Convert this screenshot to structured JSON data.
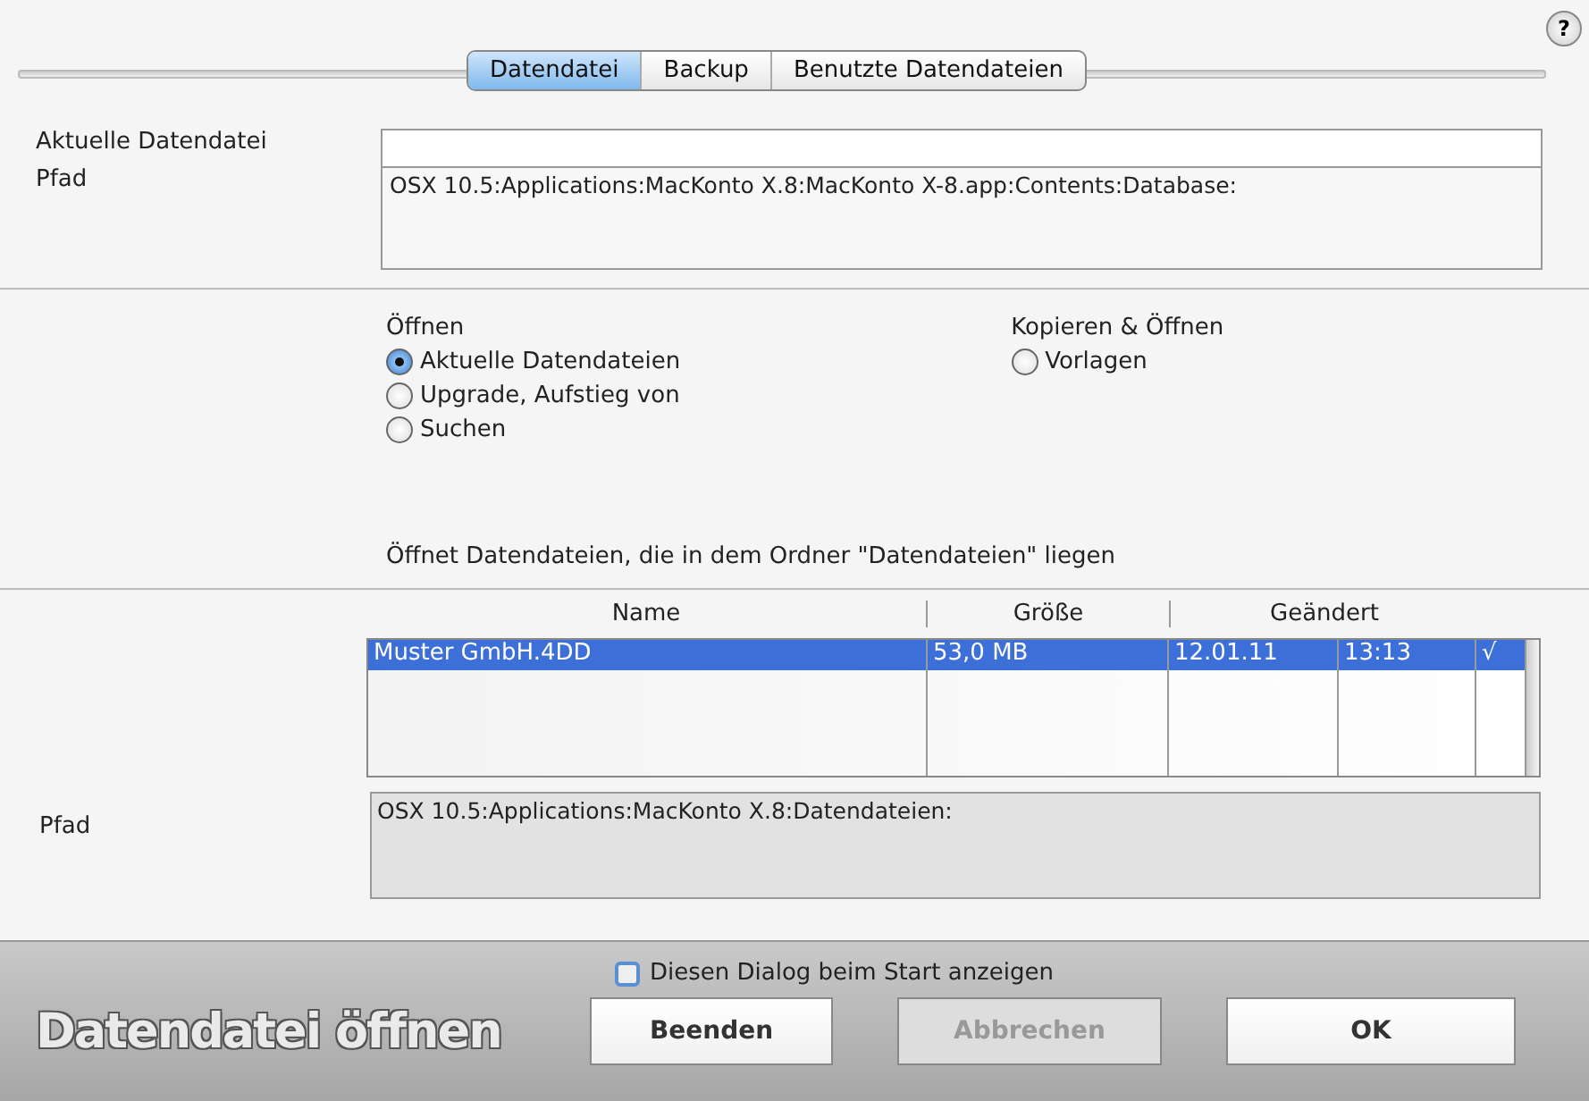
{
  "help": "?",
  "tabs": [
    {
      "label": "Datendatei",
      "selected": true
    },
    {
      "label": "Backup",
      "selected": false
    },
    {
      "label": "Benutzte Datendateien",
      "selected": false
    }
  ],
  "current_file": {
    "label": "Aktuelle Datendatei",
    "path_label": "Pfad",
    "path": "OSX 10.5:Applications:MacKonto X.8:MacKonto X-8.app:Contents:Database:"
  },
  "open_group": {
    "title": "Öffnen",
    "options": [
      {
        "label": "Aktuelle Datendateien",
        "selected": true
      },
      {
        "label": "Upgrade, Aufstieg von",
        "selected": false
      },
      {
        "label": "Suchen",
        "selected": false
      }
    ]
  },
  "copy_group": {
    "title": "Kopieren & Öffnen",
    "options": [
      {
        "label": "Vorlagen",
        "selected": false
      }
    ]
  },
  "description": "Öffnet Datendateien, die in dem Ordner \"Datendateien\" liegen",
  "table": {
    "columns": [
      "Name",
      "Größe",
      "Geändert"
    ],
    "rows": [
      {
        "name": "Muster GmbH.4DD",
        "size": "53,0 MB",
        "date": "12.01.11",
        "time": "13:13",
        "mark": "√",
        "selected": true
      }
    ]
  },
  "folder_path": {
    "label": "Pfad",
    "path": "OSX 10.5:Applications:MacKonto X.8:Datendateien:"
  },
  "footer": {
    "checkbox": {
      "label": "Diesen Dialog beim Start anzeigen",
      "checked": false
    },
    "title": "Datendatei öffnen",
    "buttons": [
      {
        "label": "Beenden",
        "disabled": false
      },
      {
        "label": "Abbrechen",
        "disabled": true
      },
      {
        "label": "OK",
        "disabled": false
      }
    ]
  }
}
